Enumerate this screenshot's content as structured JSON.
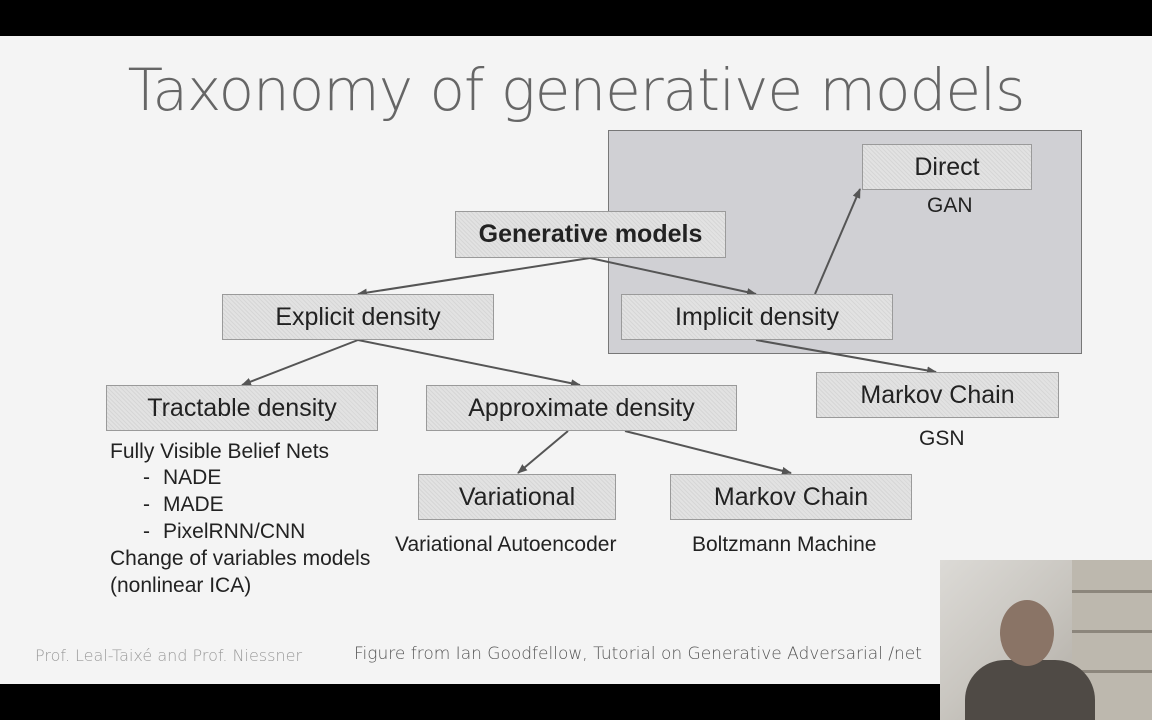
{
  "title": "Taxonomy of generative models",
  "nodes": {
    "root": "Generative models",
    "explicit": "Explicit density",
    "implicit": "Implicit density",
    "direct": "Direct",
    "tractable": "Tractable density",
    "approximate": "Approximate density",
    "markov_implicit": "Markov Chain",
    "variational": "Variational",
    "markov_approx": "Markov Chain"
  },
  "labels": {
    "gan": "GAN",
    "gsn": "GSN",
    "variational_autoencoder": "Variational Autoencoder",
    "boltzmann": "Boltzmann Machine",
    "tractable_list": {
      "line1": "Fully Visible Belief Nets",
      "item1": "NADE",
      "item2": "MADE",
      "item3": "PixelRNN/CNN",
      "bullet": "-",
      "line2": "Change of variables models",
      "line3": "(nonlinear ICA)"
    }
  },
  "footer": {
    "authors": "Prof. Leal-Taixé and Prof. Niessner",
    "source": "Figure from Ian Goodfellow, Tutorial on Generative Adversarial /net"
  },
  "colors": {
    "box_fill": "#e2e2e2",
    "implicit_region": "#9696a0",
    "arrow": "#555555"
  }
}
